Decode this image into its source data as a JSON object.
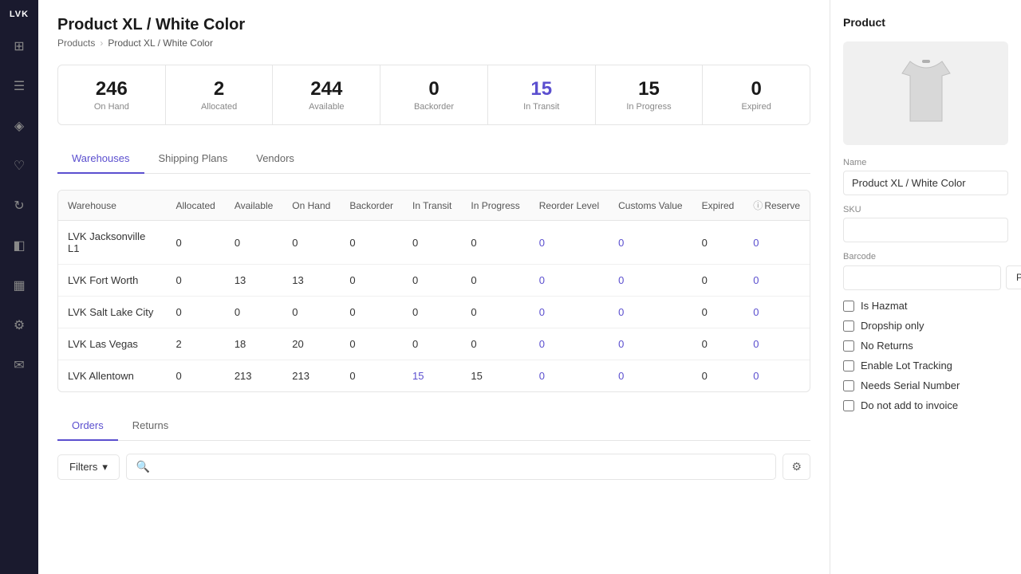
{
  "app": {
    "logo": "LVK"
  },
  "page": {
    "title": "Product XL / White Color",
    "breadcrumb": {
      "parent": "Products",
      "current": "Product XL / White Color"
    }
  },
  "stats": [
    {
      "value": "246",
      "label": "On Hand",
      "purple": false
    },
    {
      "value": "2",
      "label": "Allocated",
      "purple": false
    },
    {
      "value": "244",
      "label": "Available",
      "purple": false
    },
    {
      "value": "0",
      "label": "Backorder",
      "purple": false
    },
    {
      "value": "15",
      "label": "In Transit",
      "purple": true
    },
    {
      "value": "15",
      "label": "In Progress",
      "purple": false
    },
    {
      "value": "0",
      "label": "Expired",
      "purple": false
    }
  ],
  "tabs": [
    "Warehouses",
    "Shipping Plans",
    "Vendors"
  ],
  "active_tab": "Warehouses",
  "table": {
    "columns": [
      "Warehouse",
      "Allocated",
      "Available",
      "On Hand",
      "Backorder",
      "In Transit",
      "In Progress",
      "Reorder Level",
      "Customs Value",
      "Expired",
      "Reserve"
    ],
    "rows": [
      {
        "warehouse": "LVK Jacksonville L1",
        "allocated": "0",
        "available": "0",
        "on_hand": "0",
        "backorder": "0",
        "in_transit": "0",
        "in_progress": "0",
        "reorder_level": "0",
        "customs_value": "0",
        "expired": "0",
        "reserve": "0"
      },
      {
        "warehouse": "LVK Fort Worth",
        "allocated": "0",
        "available": "13",
        "on_hand": "13",
        "backorder": "0",
        "in_transit": "0",
        "in_progress": "0",
        "reorder_level": "0",
        "customs_value": "0",
        "expired": "0",
        "reserve": "0"
      },
      {
        "warehouse": "LVK Salt Lake City",
        "allocated": "0",
        "available": "0",
        "on_hand": "0",
        "backorder": "0",
        "in_transit": "0",
        "in_progress": "0",
        "reorder_level": "0",
        "customs_value": "0",
        "expired": "0",
        "reserve": "0"
      },
      {
        "warehouse": "LVK Las Vegas",
        "allocated": "2",
        "available": "18",
        "on_hand": "20",
        "backorder": "0",
        "in_transit": "0",
        "in_progress": "0",
        "reorder_level": "0",
        "customs_value": "0",
        "expired": "0",
        "reserve": "0"
      },
      {
        "warehouse": "LVK Allentown",
        "allocated": "0",
        "available": "213",
        "on_hand": "213",
        "backorder": "0",
        "in_transit": "15",
        "in_progress": "15",
        "reorder_level": "0",
        "customs_value": "0",
        "expired": "0",
        "reserve": "0"
      }
    ]
  },
  "bottom_tabs": [
    "Orders",
    "Returns"
  ],
  "active_bottom_tab": "Orders",
  "filters": {
    "button_label": "Filters",
    "search_placeholder": "",
    "chevron": "▾"
  },
  "panel": {
    "title": "Product",
    "name_label": "Name",
    "name_value": "Product XL / White Color",
    "sku_label": "SKU",
    "sku_value": "",
    "barcode_label": "Barcode",
    "barcode_value": "",
    "print_label": "Print",
    "checkboxes": [
      "Is Hazmat",
      "Dropship only",
      "No Returns",
      "Enable Lot Tracking",
      "Needs Serial Number",
      "Do not add to invoice"
    ]
  },
  "sidebar_icons": [
    {
      "name": "grid-icon",
      "glyph": "⊞"
    },
    {
      "name": "list-icon",
      "glyph": "≡"
    },
    {
      "name": "tag-icon",
      "glyph": "◈"
    },
    {
      "name": "heart-icon",
      "glyph": "♡"
    },
    {
      "name": "refresh-icon",
      "glyph": "↻"
    },
    {
      "name": "layers-icon",
      "glyph": "◧"
    },
    {
      "name": "chart-icon",
      "glyph": "▦"
    },
    {
      "name": "settings-icon",
      "glyph": "⚙"
    },
    {
      "name": "message-icon",
      "glyph": "✉"
    }
  ]
}
